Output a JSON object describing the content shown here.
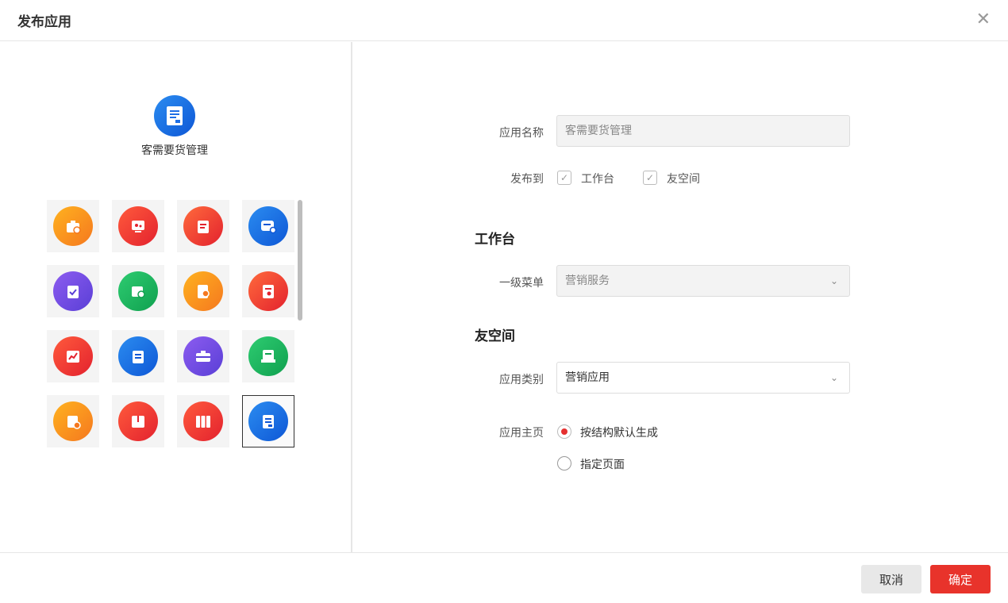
{
  "dialog": {
    "title": "发布应用",
    "close_glyph": "✕"
  },
  "preview": {
    "name": "客需要货管理",
    "icon": "document-list-icon",
    "color": "#1e6fe6"
  },
  "icons": [
    {
      "name": "briefcase-chart-icon",
      "color": [
        "#ffb21f",
        "#f5781f"
      ]
    },
    {
      "name": "monitor-gear-icon",
      "color": [
        "#ff5a3c",
        "#e3222e"
      ]
    },
    {
      "name": "clipboard-edit-icon",
      "color": [
        "#ff6a3c",
        "#e3222e"
      ]
    },
    {
      "name": "chat-gear-icon",
      "color": [
        "#2b8cf0",
        "#0e57d6"
      ]
    },
    {
      "name": "clipboard-check-icon",
      "color": [
        "#8c5cf0",
        "#5a3fd6"
      ]
    },
    {
      "name": "folder-gear-icon",
      "color": [
        "#2ecc71",
        "#10a04f"
      ]
    },
    {
      "name": "file-gear-icon",
      "color": [
        "#ffb21f",
        "#f5781f"
      ]
    },
    {
      "name": "document-gear-icon",
      "color": [
        "#ff6a3c",
        "#e3222e"
      ]
    },
    {
      "name": "report-chart-icon",
      "color": [
        "#ff5a3c",
        "#e3222e"
      ]
    },
    {
      "name": "clipboard-list-icon",
      "color": [
        "#2b8cf0",
        "#0e57d6"
      ]
    },
    {
      "name": "toolbox-icon",
      "color": [
        "#8c5cf0",
        "#5a3fd6"
      ]
    },
    {
      "name": "book-document-icon",
      "color": [
        "#2ecc71",
        "#10a04f"
      ]
    },
    {
      "name": "clipboard-add-icon",
      "color": [
        "#ffb21f",
        "#f5781f"
      ]
    },
    {
      "name": "box-icon",
      "color": [
        "#ff5a3c",
        "#e3222e"
      ]
    },
    {
      "name": "binders-icon",
      "color": [
        "#ff5a3c",
        "#e3222e"
      ]
    },
    {
      "name": "document-list-icon",
      "color": [
        "#2b8cf0",
        "#0e57d6"
      ],
      "selected": true
    }
  ],
  "form": {
    "app_name_label": "应用名称",
    "app_name_value": "客需要货管理",
    "publish_to_label": "发布到",
    "publish_workbench": "工作台",
    "publish_friend_space": "友空间",
    "section_workbench": "工作台",
    "menu_label": "一级菜单",
    "menu_value": "营销服务",
    "section_friend_space": "友空间",
    "category_label": "应用类别",
    "category_value": "营销应用",
    "homepage_label": "应用主页",
    "homepage_option_default": "按结构默认生成",
    "homepage_option_custom": "指定页面"
  },
  "footer": {
    "cancel": "取消",
    "ok": "确定"
  },
  "colors": {
    "primary": "#e8332b",
    "border": "#e6e6e6"
  }
}
